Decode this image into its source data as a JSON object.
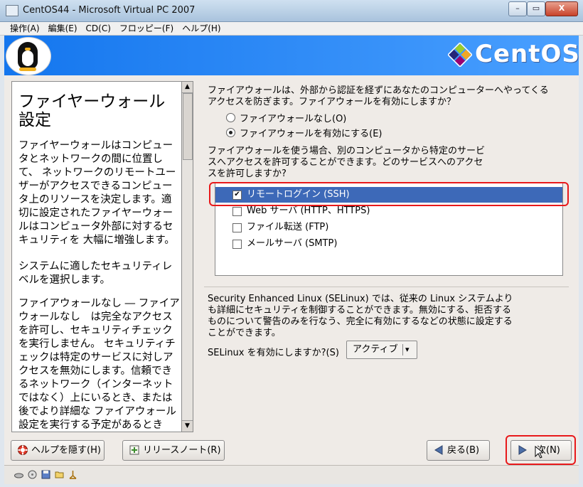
{
  "window": {
    "title": "CentOS44 - Microsoft Virtual PC 2007",
    "minimize_glyph": "–",
    "restore_glyph": "▭",
    "close_glyph": "X"
  },
  "menu": [
    "操作(A)",
    "編集(E)",
    "CD(C)",
    "フロッピー(F)",
    "ヘルプ(H)"
  ],
  "banner": {
    "logo_text": "CentOS"
  },
  "help": {
    "title": "ファイヤーウォール設定",
    "paragraphs": [
      "ファイヤーウォールはコンピュータとネットワークの間に位置して、 ネットワークのリモートユーザーがアクセスできるコンピュータ上のリソースを決定します。適切に設定されたファイヤーウォールはコンピュータ外部に対するセキュリティを 大幅に増強します。",
      "システムに適したセキュリティレベルを選択します。",
      "ファイアウォールなし ― ファイアウォールなし　は完全なアクセスを許可し、セキュリティチェックを実行しません。 セキュリティチェックは特定のサービスに対しアクセスを無効にします。信頼できるネットワーク（インターネットではなく）上にいるとき、または後でより詳細な ファイアウォール設定を実行する予定があるとき"
    ]
  },
  "firewall": {
    "question": "ファイアウォールは、外部から認証を経ずにあなたのコンピューターへやってくるアクセスを防ぎます。ファイアウォールを有効にしますか？",
    "options": [
      {
        "label": "ファイアウォールなし(O)",
        "selected": false
      },
      {
        "label": "ファイアウォールを有効にする(E)",
        "selected": true
      }
    ],
    "services_intro": "ファイアウォールを使う場合、別のコンピュータから特定のサービスへアクセスを許可することができます。どのサービスへのアクセスを許可しますか?",
    "services": [
      {
        "label": "リモートログイン (SSH)",
        "checked": true,
        "selected_row": true
      },
      {
        "label": "Web サーバ (HTTP、HTTPS)",
        "checked": false,
        "selected_row": false
      },
      {
        "label": "ファイル転送 (FTP)",
        "checked": false,
        "selected_row": false
      },
      {
        "label": "メールサーバ (SMTP)",
        "checked": false,
        "selected_row": false
      }
    ]
  },
  "selinux": {
    "description": "Security Enhanced Linux (SELinux) では、従来の Linux システムよりも詳細にセキュリティを制御することができます。無効にする、拒否するものについて警告のみを行なう、完全に有効にするなどの状態に設定することができます。",
    "prompt": "SELinux を有効にしますか?(S)",
    "value": "アクティブ",
    "arrow": "▾"
  },
  "buttons": {
    "hide_help": "ヘルプを隠す(H)",
    "release_notes": "リリースノート(R)",
    "back": "戻る(B)",
    "next": "次(N)"
  },
  "colors": {
    "banner": "#2f8cf4",
    "selection": "#3d69b8",
    "highlight_border": "#e8191b"
  }
}
